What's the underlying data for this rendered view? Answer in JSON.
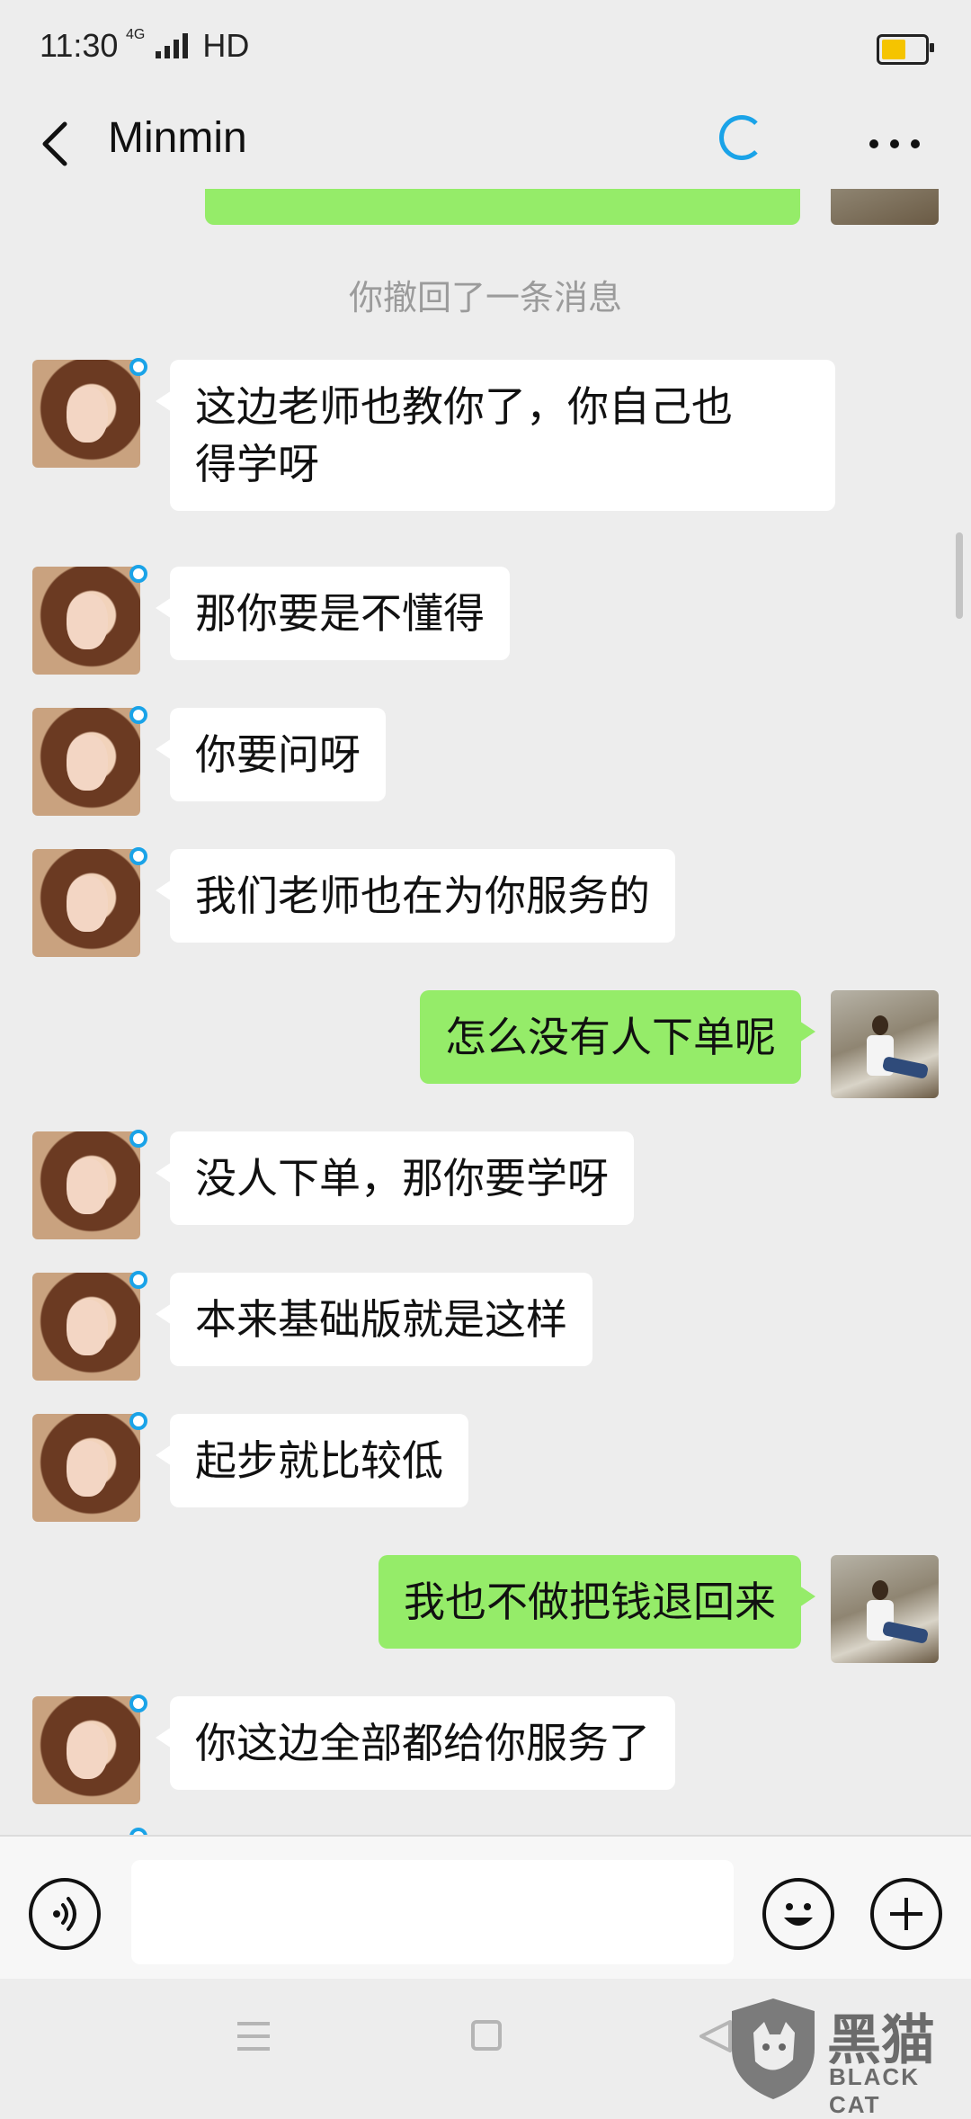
{
  "status_bar": {
    "time": "11:30",
    "network_label": "4G",
    "hd_label": "HD",
    "battery_color": "#f5c400"
  },
  "header": {
    "title": "Minmin",
    "back_icon": "chevron-left-icon",
    "loading_icon": "spinner-icon",
    "more_icon": "more-dots-icon"
  },
  "chat": {
    "recall_notice": "你撤回了一条消息",
    "messages": [
      {
        "side": "in",
        "line1": "这边老师也教你了，你自己也",
        "line2": "得学呀"
      },
      {
        "side": "in",
        "text": "那你要是不懂得"
      },
      {
        "side": "in",
        "text": "你要问呀"
      },
      {
        "side": "in",
        "text": "我们老师也在为你服务的"
      },
      {
        "side": "out",
        "text": "怎么没有人下单呢"
      },
      {
        "side": "in",
        "text": "没人下单，那你要学呀"
      },
      {
        "side": "in",
        "text": "本来基础版就是这样"
      },
      {
        "side": "in",
        "text": "起步就比较低"
      },
      {
        "side": "out",
        "text": "我也不做把钱退回来"
      },
      {
        "side": "in",
        "text": "你这边全部都给你服务了"
      }
    ],
    "outgoing_bubble_color": "#95ec69",
    "online_dot_color": "#1aa3e8"
  },
  "input_bar": {
    "voice_icon": "voice-icon",
    "emoji_icon": "emoji-icon",
    "plus_icon": "plus-icon",
    "text_value": ""
  },
  "nav_bar": {
    "menu_icon": "menu-icon",
    "home_icon": "home-icon",
    "back_icon": "back-triangle-icon"
  },
  "watermark": {
    "zh": "黑猫",
    "en": "BLACK CAT"
  }
}
